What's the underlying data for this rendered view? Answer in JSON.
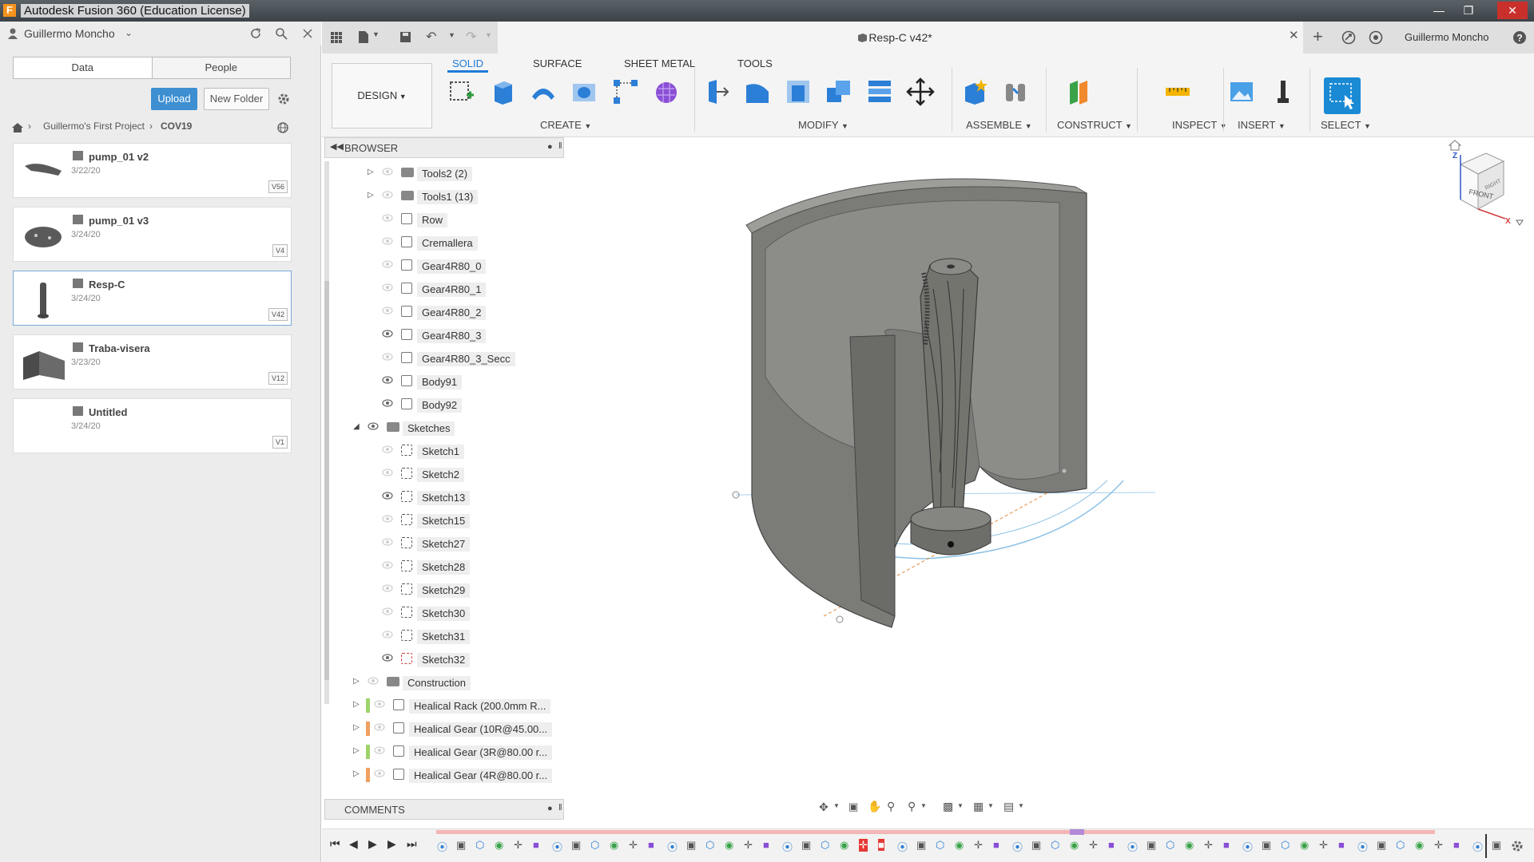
{
  "window": {
    "title": "Autodesk Fusion 360 (Education License)",
    "app_icon": "F",
    "controls": [
      "minimize-icon",
      "maximize-icon",
      "close-icon"
    ]
  },
  "data_panel": {
    "user": "Guillermo Moncho",
    "tabs": [
      "Data",
      "People"
    ],
    "upload_label": "Upload",
    "new_folder_label": "New Folder",
    "breadcrumb": [
      "Guillermo's First Project",
      "COV19"
    ],
    "files": [
      {
        "name": "pump_01 v2",
        "date": "3/22/20",
        "version": "V56"
      },
      {
        "name": "pump_01 v3",
        "date": "3/24/20",
        "version": "V4"
      },
      {
        "name": "Resp-C",
        "date": "3/24/20",
        "version": "V42"
      },
      {
        "name": "Traba-visera",
        "date": "3/23/20",
        "version": "V12"
      },
      {
        "name": "Untitled",
        "date": "3/24/20",
        "version": "V1"
      }
    ]
  },
  "document": {
    "title": "Resp-C v42*",
    "user": "Guillermo Moncho"
  },
  "toolbar": {
    "workspace": "DESIGN",
    "tabs": [
      "SOLID",
      "SURFACE",
      "SHEET METAL",
      "TOOLS"
    ],
    "groups": [
      "CREATE",
      "MODIFY",
      "ASSEMBLE",
      "CONSTRUCT",
      "INSPECT",
      "INSERT",
      "SELECT"
    ]
  },
  "browser": {
    "title": "BROWSER",
    "items": [
      {
        "label": "Tools2 (2)",
        "type": "folder"
      },
      {
        "label": "Tools1 (13)",
        "type": "folder"
      },
      {
        "label": "Row",
        "type": "body"
      },
      {
        "label": "Cremallera",
        "type": "body"
      },
      {
        "label": "Gear4R80_0",
        "type": "body"
      },
      {
        "label": "Gear4R80_1",
        "type": "body"
      },
      {
        "label": "Gear4R80_2",
        "type": "body"
      },
      {
        "label": "Gear4R80_3",
        "type": "body"
      },
      {
        "label": "Gear4R80_3_Secc",
        "type": "body"
      },
      {
        "label": "Body91",
        "type": "body"
      },
      {
        "label": "Body92",
        "type": "body"
      },
      {
        "label": "Sketches",
        "type": "folder"
      },
      {
        "label": "Sketch1",
        "type": "sketch"
      },
      {
        "label": "Sketch2",
        "type": "sketch"
      },
      {
        "label": "Sketch13",
        "type": "sketch"
      },
      {
        "label": "Sketch15",
        "type": "sketch"
      },
      {
        "label": "Sketch27",
        "type": "sketch"
      },
      {
        "label": "Sketch28",
        "type": "sketch"
      },
      {
        "label": "Sketch29",
        "type": "sketch"
      },
      {
        "label": "Sketch30",
        "type": "sketch"
      },
      {
        "label": "Sketch31",
        "type": "sketch"
      },
      {
        "label": "Sketch32",
        "type": "sketch"
      },
      {
        "label": "Construction",
        "type": "folder"
      },
      {
        "label": "Healical Rack (200.0mm R...",
        "type": "component"
      },
      {
        "label": "Healical Gear (10R@45.00...",
        "type": "component"
      },
      {
        "label": "Healical Gear (3R@80.00 r...",
        "type": "component"
      },
      {
        "label": "Healical Gear (4R@80.00 r...",
        "type": "component"
      }
    ],
    "comments_label": "COMMENTS"
  },
  "viewcube": {
    "face_front": "FRONT",
    "face_right": "RIGHT",
    "axis_x": "X",
    "axis_z": "Z"
  },
  "colors": {
    "accent": "#1f7bd6",
    "upload": "#3d8fd1",
    "select_tool": "#1a8ad4"
  }
}
